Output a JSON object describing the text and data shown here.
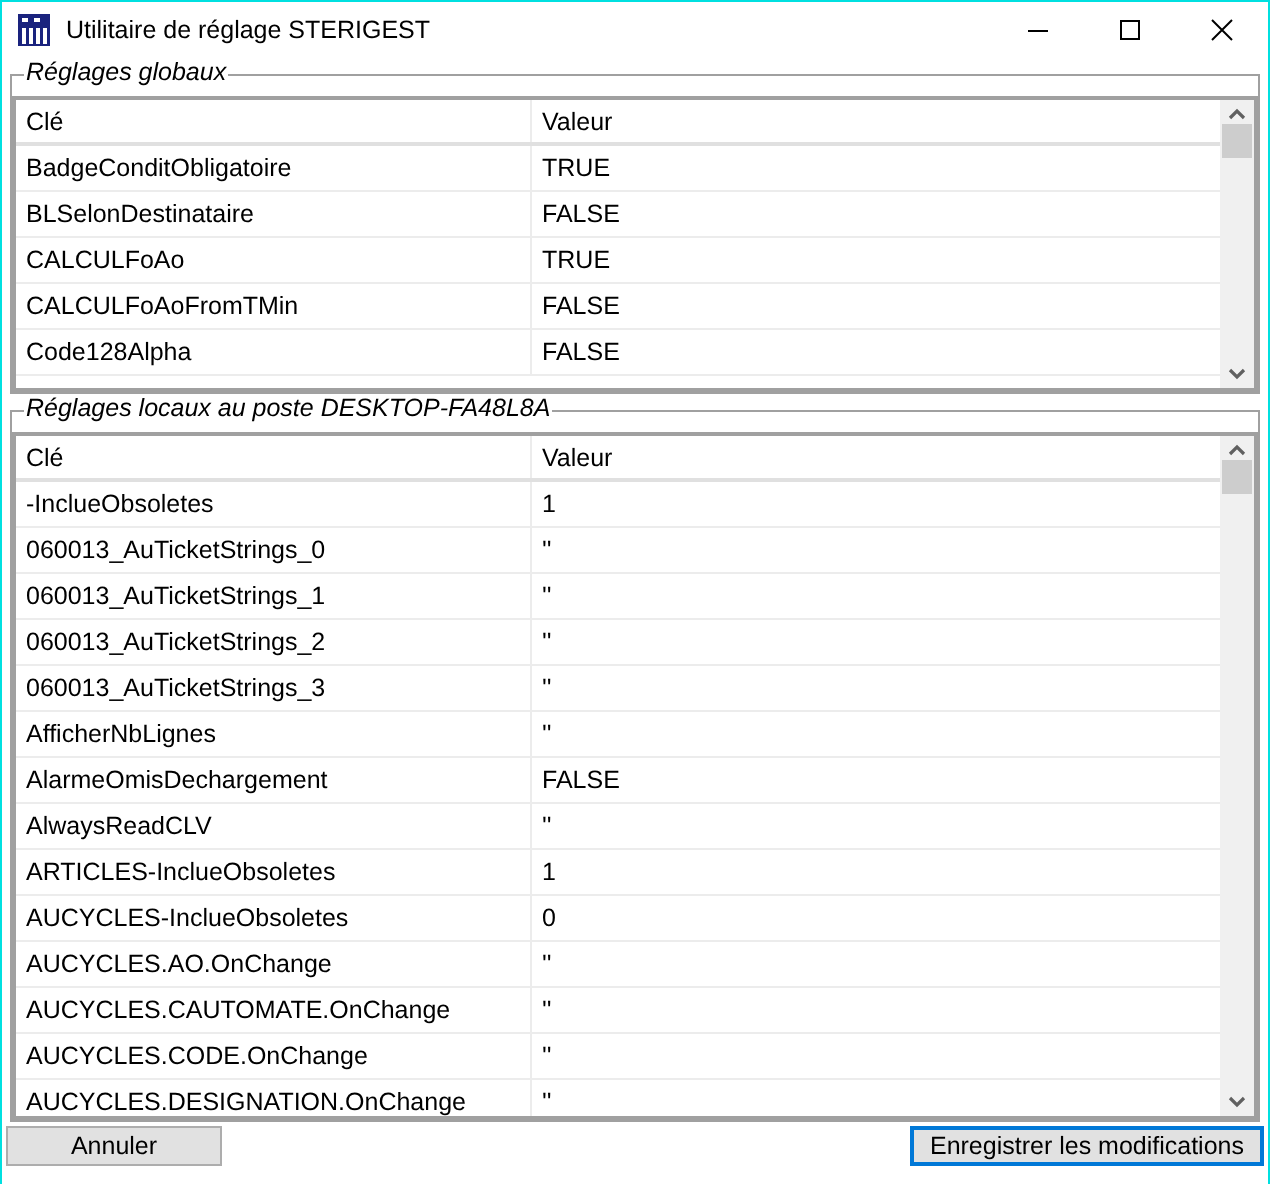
{
  "window": {
    "title": "Utilitaire de réglage STERIGEST"
  },
  "groups": [
    {
      "legend": "Réglages globaux",
      "columns": [
        "Clé",
        "Valeur"
      ],
      "rows": [
        [
          "BadgeConditObligatoire",
          "TRUE"
        ],
        [
          "BLSelonDestinataire",
          "FALSE"
        ],
        [
          "CALCULFoAo",
          "TRUE"
        ],
        [
          "CALCULFoAoFromTMin",
          "FALSE"
        ],
        [
          "Code128Alpha",
          "FALSE"
        ]
      ]
    },
    {
      "legend": "Réglages locaux au poste DESKTOP-FA48L8A",
      "columns": [
        "Clé",
        "Valeur"
      ],
      "rows": [
        [
          "-InclueObsoletes",
          "1"
        ],
        [
          "060013_AuTicketStrings_0",
          "''"
        ],
        [
          "060013_AuTicketStrings_1",
          "''"
        ],
        [
          "060013_AuTicketStrings_2",
          "''"
        ],
        [
          "060013_AuTicketStrings_3",
          "''"
        ],
        [
          "AfficherNbLignes",
          "''"
        ],
        [
          "AlarmeOmisDechargement",
          "FALSE"
        ],
        [
          "AlwaysReadCLV",
          "''"
        ],
        [
          "ARTICLES-InclueObsoletes",
          "1"
        ],
        [
          "AUCYCLES-InclueObsoletes",
          "0"
        ],
        [
          "AUCYCLES.AO.OnChange",
          "''"
        ],
        [
          "AUCYCLES.CAUTOMATE.OnChange",
          "''"
        ],
        [
          "AUCYCLES.CODE.OnChange",
          "''"
        ],
        [
          "AUCYCLES.DESIGNATION.OnChange",
          "''"
        ]
      ]
    }
  ],
  "buttons": [
    {
      "label": "Annuler",
      "default": false
    },
    {
      "label": "Enregistrer les modifications",
      "default": true
    }
  ]
}
